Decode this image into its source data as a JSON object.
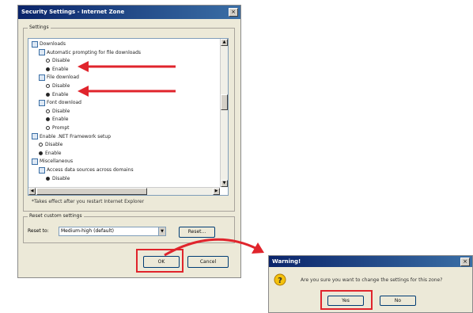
{
  "main_dialog": {
    "title": "Security Settings - Internet Zone",
    "close_glyph": "×",
    "settings_label": "Settings",
    "tree": [
      {
        "kind": "folder",
        "label": "Downloads",
        "indent": 0
      },
      {
        "kind": "folder",
        "label": "Automatic prompting for file downloads",
        "indent": 1
      },
      {
        "kind": "radio",
        "label": "Disable",
        "checked": false,
        "indent": 2
      },
      {
        "kind": "radio",
        "label": "Enable",
        "checked": true,
        "indent": 2
      },
      {
        "kind": "folder",
        "label": "File download",
        "indent": 1
      },
      {
        "kind": "radio",
        "label": "Disable",
        "checked": false,
        "indent": 2
      },
      {
        "kind": "radio",
        "label": "Enable",
        "checked": true,
        "indent": 2
      },
      {
        "kind": "folder",
        "label": "Font download",
        "indent": 1
      },
      {
        "kind": "radio",
        "label": "Disable",
        "checked": false,
        "indent": 2
      },
      {
        "kind": "radio",
        "label": "Enable",
        "checked": true,
        "indent": 2
      },
      {
        "kind": "radio",
        "label": "Prompt",
        "checked": false,
        "indent": 2
      },
      {
        "kind": "folder",
        "label": "Enable .NET Framework setup",
        "indent": 0
      },
      {
        "kind": "radio",
        "label": "Disable",
        "checked": false,
        "indent": 1
      },
      {
        "kind": "radio",
        "label": "Enable",
        "checked": true,
        "indent": 1
      },
      {
        "kind": "folder",
        "label": "Miscellaneous",
        "indent": 0
      },
      {
        "kind": "folder",
        "label": "Access data sources across domains",
        "indent": 1
      },
      {
        "kind": "radio",
        "label": "Disable",
        "checked": true,
        "indent": 2
      }
    ],
    "note": "*Takes effect after you restart Internet Explorer",
    "reset_group_label": "Reset custom settings",
    "reset_to_label": "Reset to:",
    "reset_select_value": "Medium-high (default)",
    "reset_button": "Reset...",
    "ok_button": "OK",
    "cancel_button": "Cancel"
  },
  "warning_dialog": {
    "title": "Warning!",
    "close_glyph": "×",
    "message": "Are you sure you want to change the settings for this zone?",
    "yes_button": "Yes",
    "no_button": "No"
  },
  "colors": {
    "highlight": "#e0242c",
    "title_bar": "#0a246a"
  }
}
